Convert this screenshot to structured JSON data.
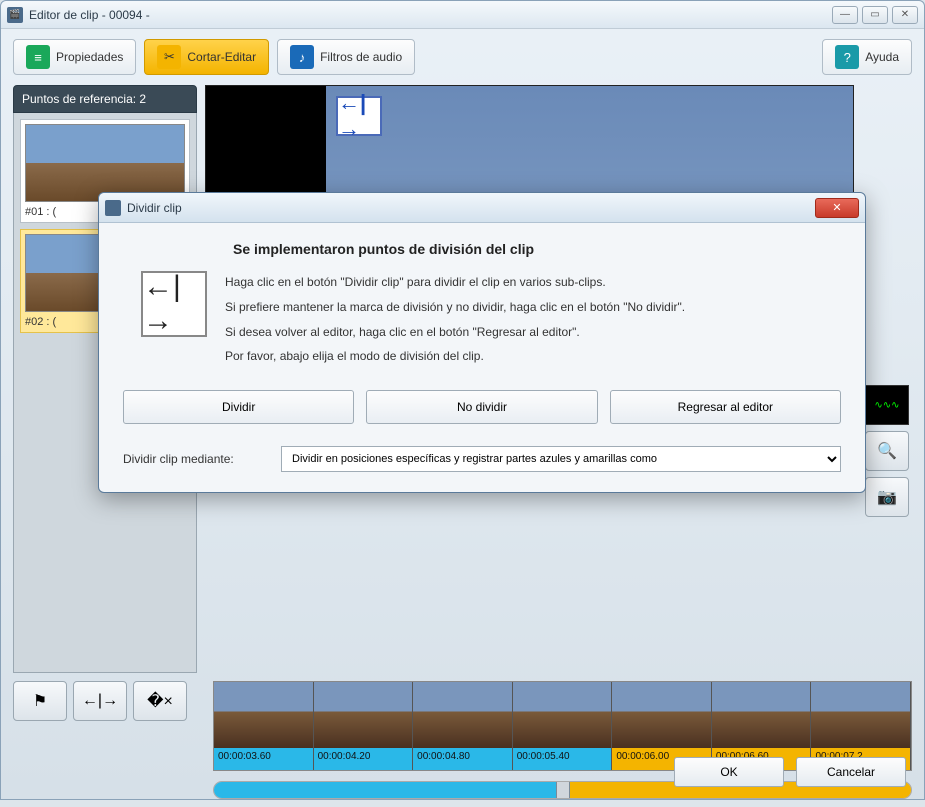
{
  "window": {
    "title": "Editor de clip - 00094 -"
  },
  "toolbar": {
    "properties": "Propiedades",
    "cut_edit": "Cortar-Editar",
    "audio_filters": "Filtros de audio",
    "help": "Ayuda"
  },
  "sidebar": {
    "ref_header": "Puntos de referencia: 2",
    "items": [
      {
        "caption": "#01 : ("
      },
      {
        "caption": "#02 : ("
      }
    ]
  },
  "timeline": {
    "frames": [
      {
        "time": "00:00:03.60",
        "zone": "blue"
      },
      {
        "time": "00:00:04.20",
        "zone": "blue"
      },
      {
        "time": "00:00:04.80",
        "zone": "blue"
      },
      {
        "time": "00:00:05.40",
        "zone": "blue"
      },
      {
        "time": "00:00:06.00",
        "zone": "yellow"
      },
      {
        "time": "00:00:06.60",
        "zone": "yellow"
      },
      {
        "time": "00:00:07.2",
        "zone": "yellow"
      }
    ]
  },
  "footer": {
    "ok": "OK",
    "cancel": "Cancelar"
  },
  "modal": {
    "title": "Dividir clip",
    "heading": "Se implementaron puntos de división del clip",
    "line1": "Haga clic en el botón \"Dividir clip\" para dividir el clip en varios sub-clips.",
    "line2": "Si prefiere mantener la marca de división y no dividir, haga clic en el botón \"No dividir\".",
    "line3": "Si desea volver al editor, haga clic en el botón \"Regresar al editor\".",
    "line4": "Por favor, abajo elija el modo de división del clip.",
    "btn_split": "Dividir",
    "btn_no_split": "No dividir",
    "btn_back": "Regresar al editor",
    "select_label": "Dividir clip mediante:",
    "select_value": "Dividir en posiciones específicas y registrar partes azules y amarillas como"
  }
}
